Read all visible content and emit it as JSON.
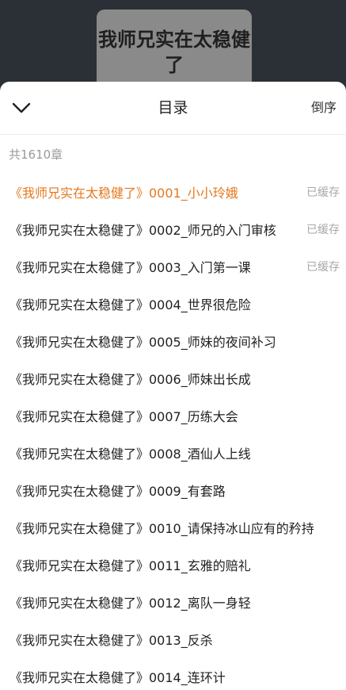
{
  "cover": {
    "title": "我师兄实在太稳健了"
  },
  "header": {
    "back_icon": "chevron-down-icon",
    "title": "目录",
    "sort_label": "倒序"
  },
  "chapter_count": "共1610章",
  "colors": {
    "active": "#e4791f",
    "muted": "#9a9a9a"
  },
  "chapters": [
    {
      "title": "《我师兄实在太稳健了》0001_小小玲娥",
      "status": "已缓存",
      "active": true
    },
    {
      "title": "《我师兄实在太稳健了》0002_师兄的入门审核",
      "status": "已缓存"
    },
    {
      "title": "《我师兄实在太稳健了》0003_入门第一课",
      "status": "已缓存"
    },
    {
      "title": "《我师兄实在太稳健了》0004_世界很危险",
      "status": ""
    },
    {
      "title": "《我师兄实在太稳健了》0005_师妹的夜间补习",
      "status": ""
    },
    {
      "title": "《我师兄实在太稳健了》0006_师妹出长成",
      "status": ""
    },
    {
      "title": "《我师兄实在太稳健了》0007_历练大会",
      "status": ""
    },
    {
      "title": "《我师兄实在太稳健了》0008_酒仙人上线",
      "status": ""
    },
    {
      "title": "《我师兄实在太稳健了》0009_有套路",
      "status": ""
    },
    {
      "title": "《我师兄实在太稳健了》0010_请保持冰山应有的矜持",
      "status": ""
    },
    {
      "title": "《我师兄实在太稳健了》0011_玄雅的赔礼",
      "status": ""
    },
    {
      "title": "《我师兄实在太稳健了》0012_离队一身轻",
      "status": ""
    },
    {
      "title": "《我师兄实在太稳健了》0013_反杀",
      "status": ""
    },
    {
      "title": "《我师兄实在太稳健了》0014_连环计",
      "status": ""
    }
  ]
}
